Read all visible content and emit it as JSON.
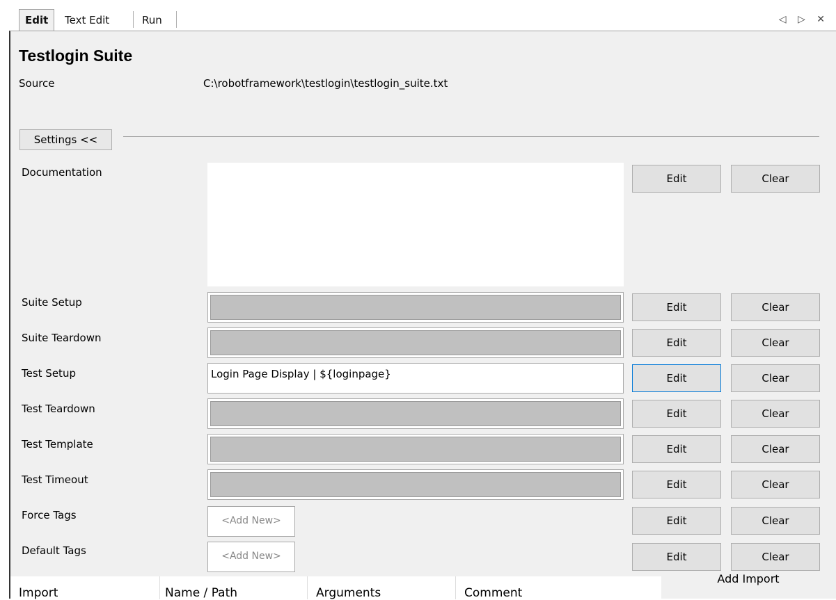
{
  "tabs": {
    "items": [
      {
        "label": "Edit",
        "active": true
      },
      {
        "label": "Text Edit",
        "active": false
      },
      {
        "label": "Run",
        "active": false
      }
    ],
    "controls": {
      "prev": "◁",
      "next": "▷",
      "close": "✕"
    }
  },
  "suite": {
    "title": "Testlogin Suite",
    "source_label": "Source",
    "source_value": "C:\\robotframework\\testlogin\\testlogin_suite.txt"
  },
  "settings": {
    "toggle_label": "Settings <<",
    "rows": [
      {
        "label": "Documentation",
        "value": "",
        "kind": "doc"
      },
      {
        "label": "Suite Setup",
        "value": "",
        "kind": "field"
      },
      {
        "label": "Suite Teardown",
        "value": "",
        "kind": "field"
      },
      {
        "label": "Test Setup",
        "value": "Login Page Display | ${loginpage}",
        "kind": "text"
      },
      {
        "label": "Test Teardown",
        "value": "",
        "kind": "field"
      },
      {
        "label": "Test Template",
        "value": "",
        "kind": "field"
      },
      {
        "label": "Test Timeout",
        "value": "",
        "kind": "field"
      },
      {
        "label": "Force Tags",
        "value": "<Add New>",
        "kind": "tag"
      },
      {
        "label": "Default Tags",
        "value": "<Add New>",
        "kind": "tag"
      }
    ],
    "edit_label": "Edit",
    "clear_label": "Clear"
  },
  "imports": {
    "columns": [
      "Import",
      "Name / Path",
      "Arguments",
      "Comment"
    ],
    "add_label": "Add Import"
  }
}
